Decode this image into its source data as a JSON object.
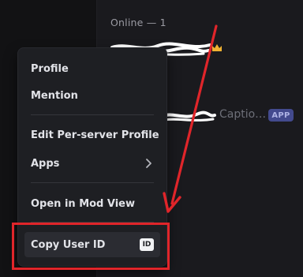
{
  "member_list": {
    "section_header": "Online — 1",
    "bot_name_partial": "Captio…",
    "bot_badge": "APP"
  },
  "context_menu": {
    "profile": "Profile",
    "mention": "Mention",
    "edit_server_profile": "Edit Per-server Profile",
    "apps": "Apps",
    "open_mod_view": "Open in Mod View",
    "copy_user_id": "Copy User ID",
    "id_badge": "ID"
  },
  "colors": {
    "annotation": "#e0252a",
    "menu_background": "#1e1f23",
    "app_badge": "#434a8e"
  },
  "icons": [
    "crown-icon",
    "chevron-right-icon",
    "id-icon"
  ]
}
